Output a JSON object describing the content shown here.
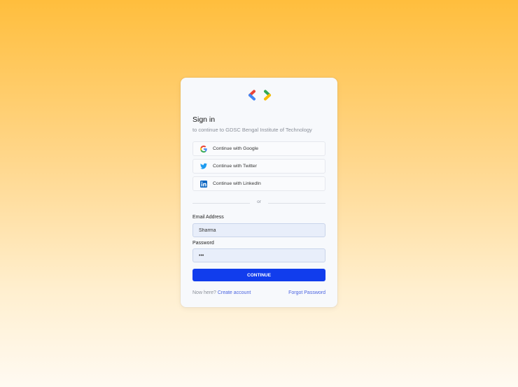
{
  "signin": {
    "title": "Sign in",
    "subtitle": "to continue to GDSC Bengal Institute of Technology"
  },
  "social": [
    {
      "label": "Continue with Google",
      "icon": "google-icon"
    },
    {
      "label": "Continue with Twitter",
      "icon": "twitter-icon"
    },
    {
      "label": "Continue with LinkedIn",
      "icon": "linkedin-icon"
    }
  ],
  "divider": {
    "text": "or"
  },
  "form": {
    "email_label": "Email Address",
    "email_value": "Sharma",
    "password_label": "Password",
    "password_value": "•••",
    "continue_label": "CONTINUE"
  },
  "footer": {
    "new_here": "Now here?",
    "create_account": "Create account",
    "forgot_password": "Forgot Password"
  },
  "colors": {
    "primary": "#113ded",
    "link": "#4a63e0",
    "logo_red": "#ea4335",
    "logo_blue": "#4285f4",
    "logo_green": "#34a853",
    "logo_yellow": "#fbbc04"
  }
}
